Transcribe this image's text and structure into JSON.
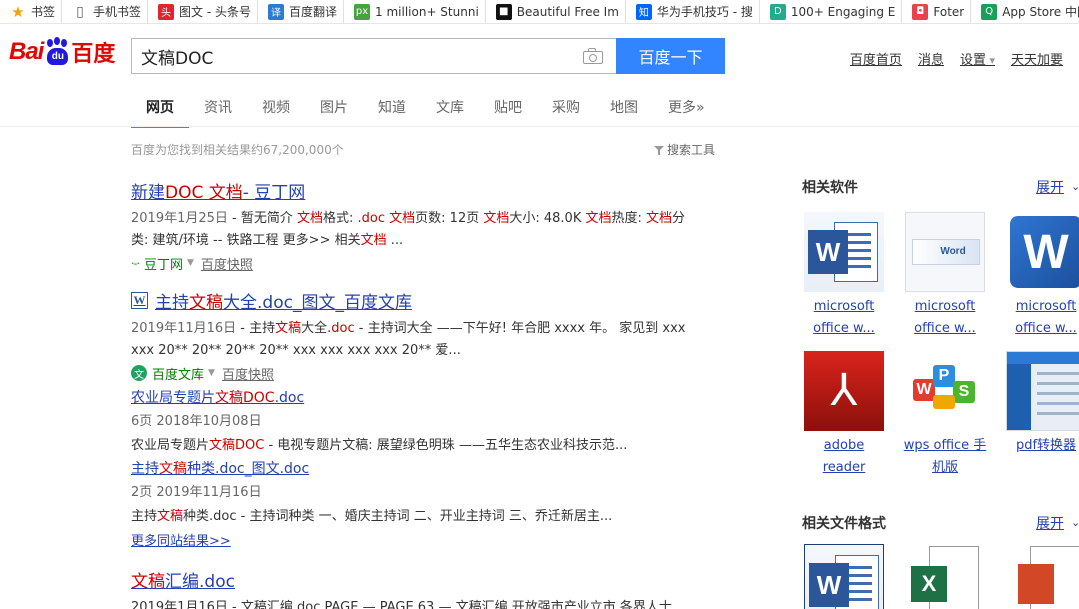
{
  "bookmarks": [
    {
      "label": "书签",
      "icon": "star-icon",
      "color": "#f2a100"
    },
    {
      "label": "手机书签",
      "icon": "phone-icon",
      "color": "#666666"
    },
    {
      "label": "图文 - 头条号",
      "icon": "toutiao-icon",
      "color": "#e0262b"
    },
    {
      "label": "百度翻译",
      "icon": "baidu-translate-icon",
      "color": "#2a7ad6"
    },
    {
      "label": "1 million+ Stunni",
      "icon": "pixabay-icon",
      "color": "#48a23f"
    },
    {
      "label": "Beautiful Free Im",
      "icon": "unsplash-icon",
      "color": "#111111"
    },
    {
      "label": "华为手机技巧 - 搜",
      "icon": "zhihu-icon",
      "color": "#0066ff"
    },
    {
      "label": "100+ Engaging E",
      "icon": "doc-icon",
      "color": "#27a98c"
    },
    {
      "label": "Foter",
      "icon": "foter-icon",
      "color": "#e8424b"
    },
    {
      "label": "App Store 中国",
      "icon": "q-icon",
      "color": "#18a058"
    }
  ],
  "header": {
    "logo_bai": "Bai",
    "logo_du_paw": "du",
    "logo_du": "百度",
    "query": "文稿DOC",
    "search_button": "百度一下",
    "top_links": [
      "百度首页",
      "消息",
      "设置",
      "天天加要"
    ]
  },
  "tabs": [
    "网页",
    "资讯",
    "视频",
    "图片",
    "知道",
    "文库",
    "贴吧",
    "采购",
    "地图",
    "更多»"
  ],
  "result_count": "百度为您找到相关结果约67,200,000个",
  "search_tools": "搜索工具",
  "results": {
    "r1": {
      "title_a": "新建",
      "title_b": "DOC 文档",
      "title_c": " - 豆丁网",
      "abs_date": "2019年1月25日",
      "abs_l1": " - 暂无简介 ",
      "abs_l1_em1": "文档",
      "abs_l1_b": "格式: .",
      "abs_l1_em2": "doc 文档",
      "abs_l1_c": "页数: 12页 ",
      "abs_l1_em3": "文档",
      "abs_l1_d": "大小: 48.0K ",
      "abs_l1_em4": "文档",
      "abs_l1_e": "热度: ",
      "abs_l1_em5": "文档",
      "abs_l1_f": "分",
      "abs_l2": "类: 建筑/环境 -- 铁路工程 更多>> 相关",
      "abs_l2_em": "文档",
      "abs_l2_b": " ...",
      "src_logo": "·-·",
      "src_name": "豆丁网",
      "snapshot": "百度快照"
    },
    "r2": {
      "title_a": "主持",
      "title_b": "文稿",
      "title_c": "大全.doc_图文_百度文库",
      "abs_date": "2019年11月16日",
      "abs_l1": " - 主持",
      "abs_l1_em1": "文稿",
      "abs_l1_b": "大全.",
      "abs_l1_em2": "doc",
      "abs_l1_c": " - 主持词大全 ——下午好! 年合肥 xxxx 年。 家见到 xxx",
      "abs_l2": "xxx 20** 20** 20** 20** xxx xxx xxx xxx 20** 爱...",
      "src_name": "百度文库",
      "snapshot": "百度快照",
      "subs": [
        {
          "title_a": "农业局专题片",
          "title_b": "文稿DOC",
          "title_c": ".doc",
          "meta": "6页   2018年10月08日",
          "abs_a": "农业局专题片",
          "abs_em": "文稿DOC",
          "abs_b": " - 电视专题片文稿: 展望绿色明珠 ——五华生态农业科技示范..."
        },
        {
          "title_a": "主持",
          "title_b": "文稿",
          "title_c": "种类.doc_图文.doc",
          "meta": "2页   2019年11月16日",
          "abs_a": "主持",
          "abs_em": "文稿",
          "abs_b": "种类.doc - 主持词种类 一、婚庆主持词 二、开业主持词 三、乔迁新居主..."
        }
      ],
      "more": "更多同站结果>>"
    },
    "r3": {
      "title_a": "文稿",
      "title_b": "汇编.doc",
      "abs": "2019年1月16日 - 文稿汇编.doc.PAGE — PAGE 63 — 文稿汇编 开放强市产业立市 各界人士"
    }
  },
  "sidebar": {
    "software_heading": "相关软件",
    "expand_label": "展开",
    "apps": [
      {
        "name_l1": "microsoft",
        "name_l2": "office w..."
      },
      {
        "name_l1": "microsoft",
        "name_l2": "office w..."
      },
      {
        "name_l1": "microsoft",
        "name_l2": "office w..."
      },
      {
        "name_l1": "adobe",
        "name_l2": "reader"
      },
      {
        "name_l1": "wps office 手",
        "name_l2": "机版"
      },
      {
        "name_l1": "pdf转换器",
        "name_l2": ""
      }
    ],
    "splash_text": "Word",
    "formats_heading": "相关文件格式",
    "formats_expand_label": "展开"
  },
  "colors": {
    "link": "#2440b3",
    "highlight": "#cc0000",
    "button": "#3385ff",
    "brand_red": "#e10602",
    "brand_blue": "#2319dc",
    "source_green": "#008000"
  }
}
